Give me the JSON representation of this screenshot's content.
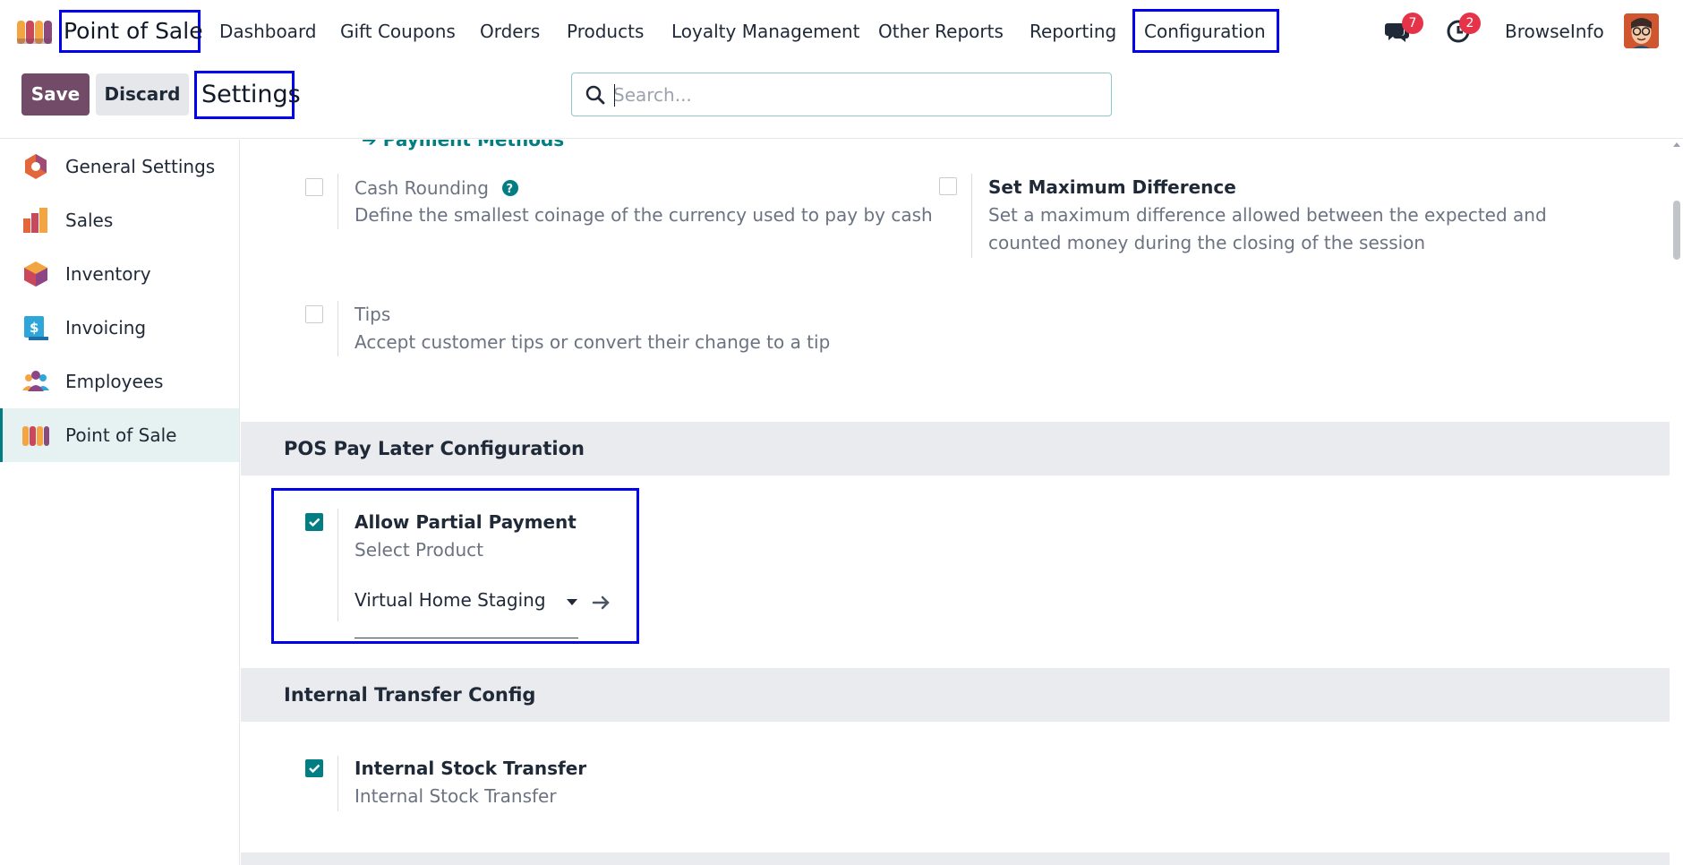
{
  "navbar": {
    "brand": "Point of Sale",
    "menu": [
      "Dashboard",
      "Gift Coupons",
      "Orders",
      "Products",
      "Loyalty Management",
      "Other Reports",
      "Reporting",
      "Configuration"
    ],
    "messages_count": "7",
    "activities_count": "2",
    "company": "BrowseInfo"
  },
  "control": {
    "save_label": "Save",
    "discard_label": "Discard",
    "title": "Settings",
    "search_placeholder": "Search..."
  },
  "sidebar": {
    "items": [
      {
        "label": "General Settings",
        "icon": "general-settings-icon"
      },
      {
        "label": "Sales",
        "icon": "sales-icon"
      },
      {
        "label": "Inventory",
        "icon": "inventory-icon"
      },
      {
        "label": "Invoicing",
        "icon": "invoicing-icon"
      },
      {
        "label": "Employees",
        "icon": "employees-icon"
      },
      {
        "label": "Point of Sale",
        "icon": "point-of-sale-icon",
        "active": true
      }
    ]
  },
  "main": {
    "payment_methods_link": "Payment Methods",
    "cash_rounding": {
      "title": "Cash Rounding",
      "desc": "Define the smallest coinage of the currency used to pay by cash",
      "checked": false
    },
    "max_difference": {
      "title": "Set Maximum Difference",
      "desc_line1": "Set a maximum difference allowed between the expected and",
      "desc_line2": "counted money during the closing of the session",
      "checked": false
    },
    "tips": {
      "title": "Tips",
      "desc": "Accept customer tips or convert their change to a tip",
      "checked": false
    },
    "pay_later_section": "POS Pay Later Configuration",
    "partial_payment": {
      "title": "Allow Partial Payment",
      "desc": "Select Product",
      "product": "Virtual Home Staging",
      "checked": true
    },
    "internal_transfer_section": "Internal Transfer Config",
    "internal_stock": {
      "title": "Internal Stock Transfer",
      "desc": "Internal Stock Transfer",
      "checked": true
    }
  },
  "colors": {
    "primary": "#714b67",
    "accent": "#017e84",
    "badge": "#e5334a",
    "annotation": "#0000ee"
  }
}
